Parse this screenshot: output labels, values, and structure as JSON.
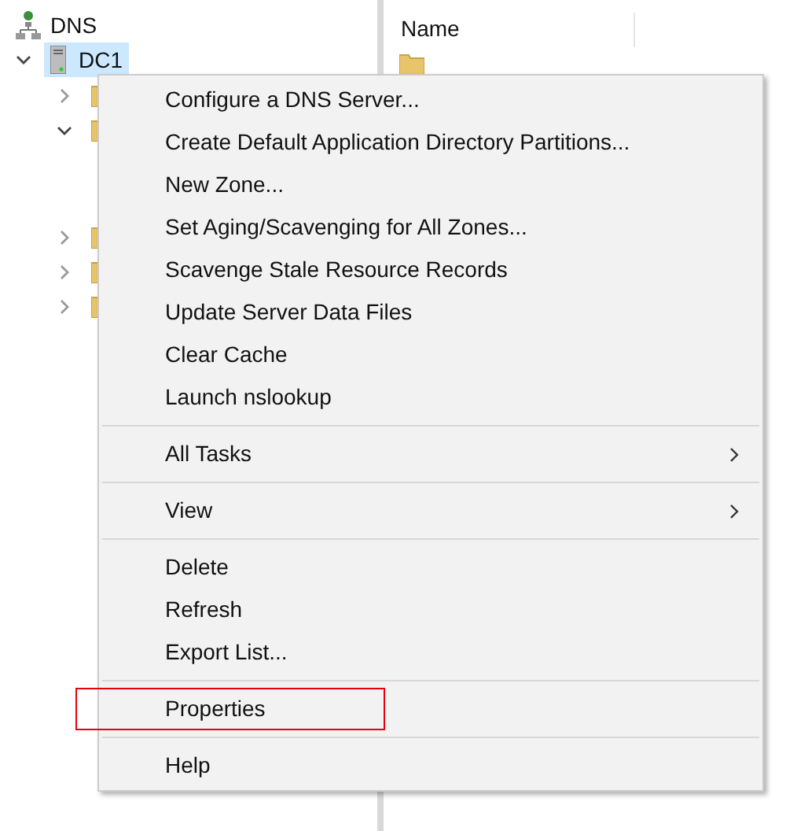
{
  "tree": {
    "root": {
      "label": "DNS"
    },
    "server": {
      "label": "DC1",
      "selected": true,
      "expanded": true
    },
    "folders": [
      {
        "expanded": false
      },
      {
        "expanded": true
      },
      {
        "expanded": false
      },
      {
        "expanded": false
      },
      {
        "expanded": false
      }
    ]
  },
  "list": {
    "columns": [
      "Name"
    ]
  },
  "context_menu": {
    "sections": [
      [
        {
          "label": "Configure a DNS Server...",
          "submenu": false,
          "outlined": false
        },
        {
          "label": "Create Default Application Directory Partitions...",
          "submenu": false,
          "outlined": false
        },
        {
          "label": "New Zone...",
          "submenu": false,
          "outlined": false
        },
        {
          "label": "Set Aging/Scavenging for All Zones...",
          "submenu": false,
          "outlined": false
        },
        {
          "label": "Scavenge Stale Resource Records",
          "submenu": false,
          "outlined": false
        },
        {
          "label": "Update Server Data Files",
          "submenu": false,
          "outlined": false
        },
        {
          "label": "Clear Cache",
          "submenu": false,
          "outlined": false
        },
        {
          "label": "Launch nslookup",
          "submenu": false,
          "outlined": false
        }
      ],
      [
        {
          "label": "All Tasks",
          "submenu": true,
          "outlined": false
        }
      ],
      [
        {
          "label": "View",
          "submenu": true,
          "outlined": false
        }
      ],
      [
        {
          "label": "Delete",
          "submenu": false,
          "outlined": false
        },
        {
          "label": "Refresh",
          "submenu": false,
          "outlined": false
        },
        {
          "label": "Export List...",
          "submenu": false,
          "outlined": false
        }
      ],
      [
        {
          "label": "Properties",
          "submenu": false,
          "outlined": true
        }
      ],
      [
        {
          "label": "Help",
          "submenu": false,
          "outlined": false
        }
      ]
    ]
  }
}
